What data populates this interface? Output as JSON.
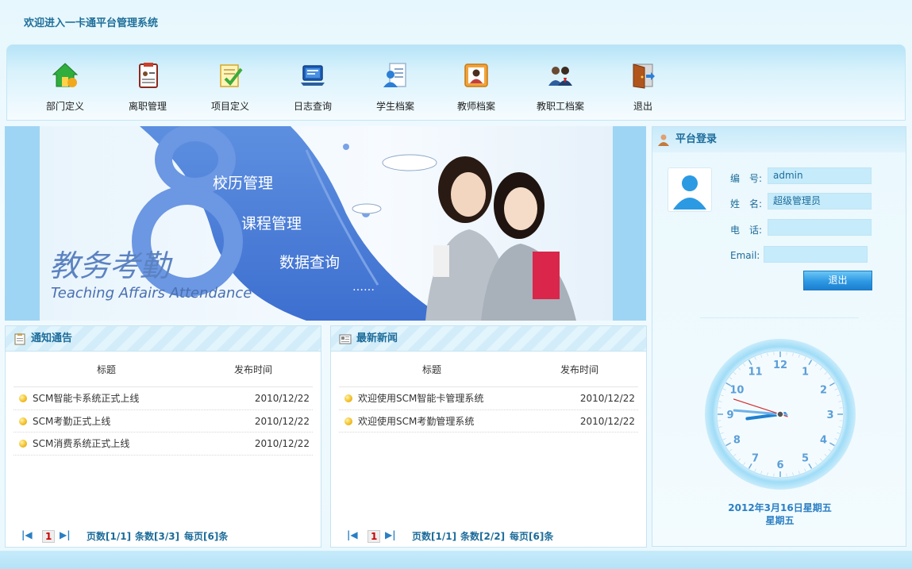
{
  "header": {
    "title": "欢迎进入一卡通平台管理系统"
  },
  "toolbar": {
    "items": [
      {
        "label": "部门定义",
        "icon": "home-icon"
      },
      {
        "label": "离职管理",
        "icon": "id-card-icon"
      },
      {
        "label": "项目定义",
        "icon": "checklist-icon"
      },
      {
        "label": "日志查询",
        "icon": "laptop-icon"
      },
      {
        "label": "学生档案",
        "icon": "student-file-icon"
      },
      {
        "label": "教师档案",
        "icon": "teacher-file-icon"
      },
      {
        "label": "教职工档案",
        "icon": "staff-group-icon"
      },
      {
        "label": "退出",
        "icon": "exit-door-icon"
      }
    ]
  },
  "banner": {
    "menu": [
      "校历管理",
      "课程管理",
      "数据查询",
      "……"
    ],
    "title_cn": "教务考勤",
    "title_en": "Teaching Affairs Attendance"
  },
  "notices": {
    "title": "通知通告",
    "col_title": "标题",
    "col_date": "发布时间",
    "rows": [
      {
        "title": "SCM智能卡系统正式上线",
        "date": "2010/12/22"
      },
      {
        "title": "SCM考勤正式上线",
        "date": "2010/12/22"
      },
      {
        "title": "SCM消费系统正式上线",
        "date": "2010/12/22"
      }
    ],
    "pager": {
      "current": "1",
      "pages": "页数[1/1]",
      "count": "条数[3/3]",
      "per": "每页[6]条"
    }
  },
  "news": {
    "title": "最新新闻",
    "col_title": "标题",
    "col_date": "发布时间",
    "rows": [
      {
        "title": "欢迎使用SCM智能卡管理系统",
        "date": "2010/12/22"
      },
      {
        "title": "欢迎使用SCM考勤管理系统",
        "date": "2010/12/22"
      }
    ],
    "pager": {
      "current": "1",
      "pages": "页数[1/1]",
      "count": "条数[2/2]",
      "per": "每页[6]条"
    }
  },
  "login": {
    "title": "平台登录",
    "id_label": "编　号:",
    "id_value": "admin",
    "name_label": "姓　名:",
    "name_value": "超级管理员",
    "phone_label": "电　话:",
    "phone_value": "",
    "email_label": "Email:",
    "email_value": "",
    "logout_label": "退出",
    "date_line": "2012年3月16日星期五",
    "weekday_line": "星期五"
  },
  "clock": {
    "hour": 8,
    "minute": 45,
    "second": 48
  },
  "colors": {
    "accent": "#1d6c9a",
    "link": "#2a7fc4",
    "button": "#2d98e3"
  }
}
